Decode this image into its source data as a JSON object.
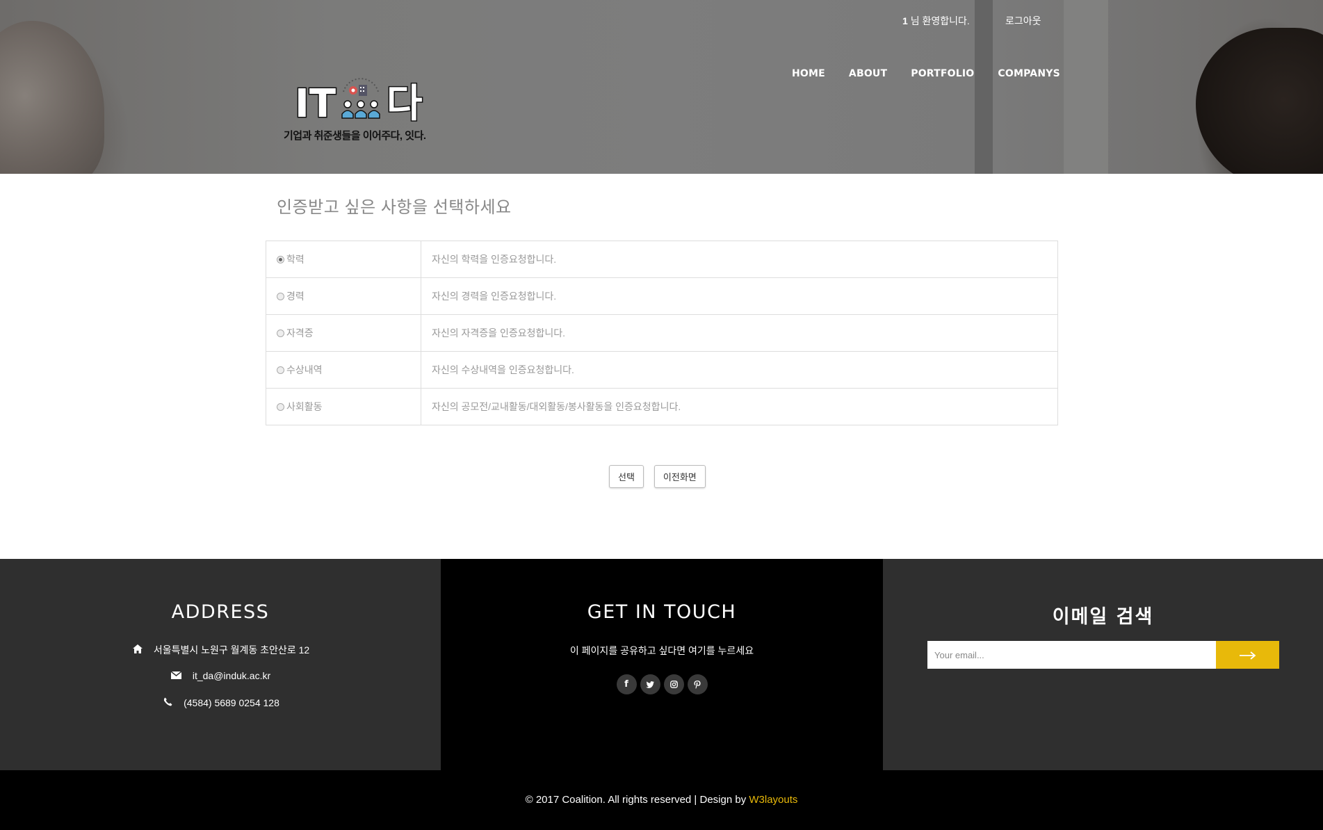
{
  "header": {
    "user_id": "1",
    "welcome_suffix": "님 환영합니다.",
    "logout_label": "로그아웃",
    "nav": [
      "HOME",
      "ABOUT",
      "PORTFOLIO",
      "COMPANYS"
    ],
    "logo": {
      "left_text": "IT",
      "right_text": "다",
      "tagline": "기업과 취준생들을 이어주다, 잇다."
    }
  },
  "main": {
    "title": "인증받고 싶은 사항을 선택하세요",
    "options": [
      {
        "label": "학력",
        "description": "자신의 학력을 인증요청합니다.",
        "checked": true
      },
      {
        "label": "경력",
        "description": "자신의 경력을 인증요청합니다.",
        "checked": false
      },
      {
        "label": "자격증",
        "description": "자신의 자격증을 인증요청합니다.",
        "checked": false
      },
      {
        "label": "수상내역",
        "description": "자신의 수상내역을 인증요청합니다.",
        "checked": false
      },
      {
        "label": "사회활동",
        "description": "자신의 공모전/교내활동/대외활동/봉사활동을 인증요청합니다.",
        "checked": false
      }
    ],
    "select_button": "선택",
    "back_button": "이전화면"
  },
  "footer": {
    "address": {
      "title": "ADDRESS",
      "street": "서울특별시 노원구 월계동 초안산로 12",
      "email": "it_da@induk.ac.kr",
      "phone": "(4584) 5689 0254 128"
    },
    "touch": {
      "title": "GET IN TOUCH",
      "text": "이 페이지를 공유하고 싶다면 여기를 누르세요",
      "socials": [
        "facebook",
        "twitter",
        "instagram",
        "pinterest"
      ]
    },
    "search": {
      "title": "이메일 검색",
      "placeholder": "Your email...",
      "submit_icon": "arrow-right-icon"
    },
    "copyright_text": "© 2017 Coalition. All rights reserved | Design by ",
    "copyright_link": "W3layouts"
  },
  "colors": {
    "accent": "#e8b90a",
    "footer_dark": "#2f2f2f",
    "footer_black": "#000000"
  }
}
